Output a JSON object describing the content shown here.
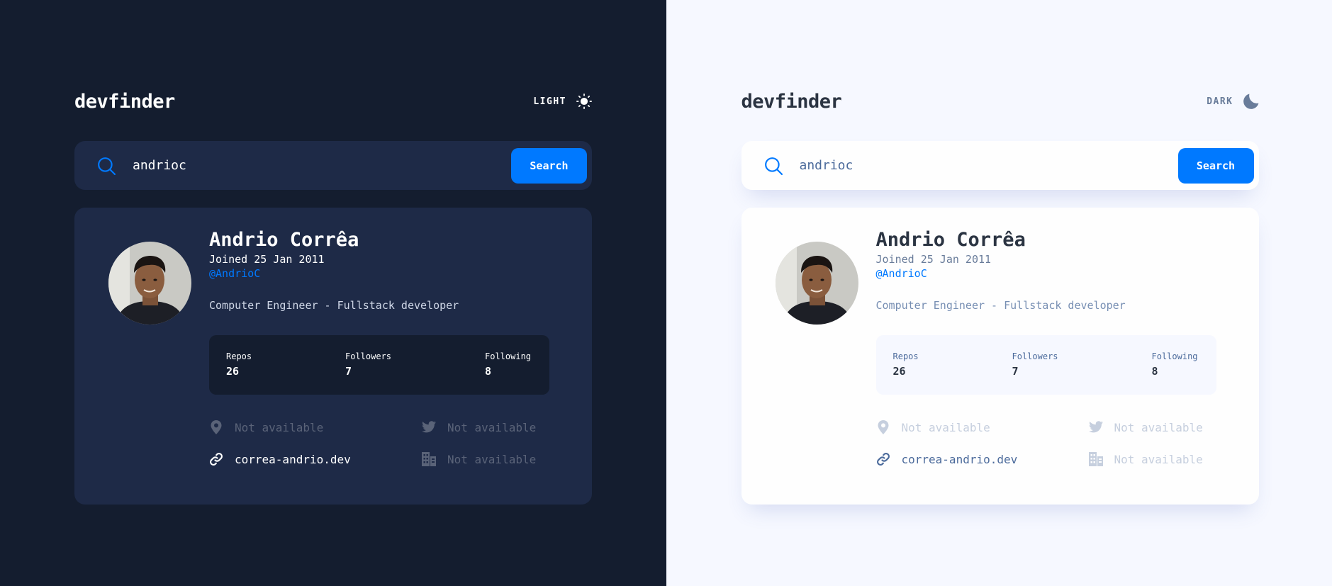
{
  "panels": [
    {
      "theme": "dark",
      "logo": "devfinder",
      "toggle_label": "LIGHT",
      "toggle_icon": "sun-icon",
      "search": {
        "value": "andrioc",
        "button_label": "Search"
      },
      "profile": {
        "name": "Andrio Corrêa",
        "joined": "Joined 25 Jan 2011",
        "handle": "@AndrioC",
        "bio": "Computer Engineer - Fullstack developer",
        "stats": {
          "repos_label": "Repos",
          "repos": "26",
          "followers_label": "Followers",
          "followers": "7",
          "following_label": "Following",
          "following": "8"
        },
        "location": "Not available",
        "twitter": "Not available",
        "website": "correa-andrio.dev",
        "company": "Not available"
      }
    },
    {
      "theme": "light",
      "logo": "devfinder",
      "toggle_label": "DARK",
      "toggle_icon": "moon-icon",
      "search": {
        "value": "andrioc",
        "button_label": "Search"
      },
      "profile": {
        "name": "Andrio Corrêa",
        "joined": "Joined 25 Jan 2011",
        "handle": "@AndrioC",
        "bio": "Computer Engineer - Fullstack developer",
        "stats": {
          "repos_label": "Repos",
          "repos": "26",
          "followers_label": "Followers",
          "followers": "7",
          "following_label": "Following",
          "following": "8"
        },
        "location": "Not available",
        "twitter": "Not available",
        "website": "correa-andrio.dev",
        "company": "Not available"
      }
    }
  ],
  "colors": {
    "accent": "#0079ff",
    "dark_bg": "#141d2f",
    "dark_card": "#1e2a47",
    "light_bg": "#f6f8ff",
    "light_card": "#fefefe"
  }
}
